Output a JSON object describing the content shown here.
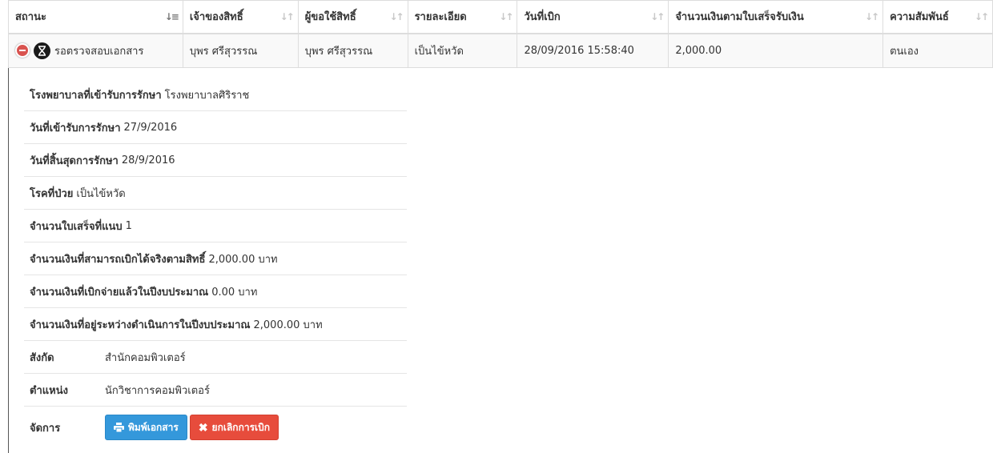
{
  "table": {
    "headers": [
      {
        "label": "สถานะ"
      },
      {
        "label": "เจ้าของสิทธิ์"
      },
      {
        "label": "ผู้ขอใช้สิทธิ์"
      },
      {
        "label": "รายละเอียด"
      },
      {
        "label": "วันที่เบิก"
      },
      {
        "label": "จำนวนเงินตามใบเสร็จรับเงิน"
      },
      {
        "label": "ความสัมพันธ์"
      }
    ],
    "sorted_column": "สถานะ",
    "row": {
      "status": "รอตรวจสอบเอกสาร",
      "owner": "บุพร ศรีสุวรรณ",
      "requester": "บุพร ศรีสุวรรณ",
      "detail": "เป็นไข้หวัด",
      "date": "28/09/2016 15:58:40",
      "amount": "2,000.00",
      "relation": "ตนเอง"
    }
  },
  "details": {
    "hospital_label": "โรงพยาบาลที่เข้ารับการรักษา",
    "hospital_value": "โรงพยาบาลศิริราช",
    "admit_label": "วันที่เข้ารับการรักษา",
    "admit_value": "27/9/2016",
    "end_label": "วันที่สิ้นสุดการรักษา",
    "end_value": "28/9/2016",
    "disease_label": "โรคที่ป่วย",
    "disease_value": "เป็นไข้หวัด",
    "receipts_label": "จำนวนใบเสร็จที่แนบ",
    "receipts_value": "1",
    "eligible_label": "จำนวนเงินที่สามารถเบิกได้จริงตามสิทธิ์",
    "eligible_value": "2,000.00 บาท",
    "paid_label": "จำนวนเงินที่เบิกจ่ายแล้วในปีงบประมาณ",
    "paid_value": "0.00 บาท",
    "pending_label": "จำนวนเงินที่อยู่ระหว่างดำเนินการในปีงบประมาณ",
    "pending_value": "2,000.00 บาท",
    "dept_label": "สังกัด",
    "dept_value": "สำนักคอมพิวเตอร์",
    "position_label": "ตำแหน่ง",
    "position_value": "นักวิชาการคอมพิวเตอร์",
    "manage_label": "จัดการ"
  },
  "actions": {
    "print_label": "พิมพ์เอกสาร",
    "cancel_label": "ยกเลิกการเบิก"
  },
  "colors": {
    "print_button": "#3498db",
    "cancel_button": "#e74c3c",
    "collapse_icon": "#d9534f"
  },
  "icons": {
    "collapse": "minus-circle-icon",
    "status": "hourglass-icon",
    "print": "print-icon",
    "cancel": "times-icon",
    "sort": "sort-icon"
  }
}
